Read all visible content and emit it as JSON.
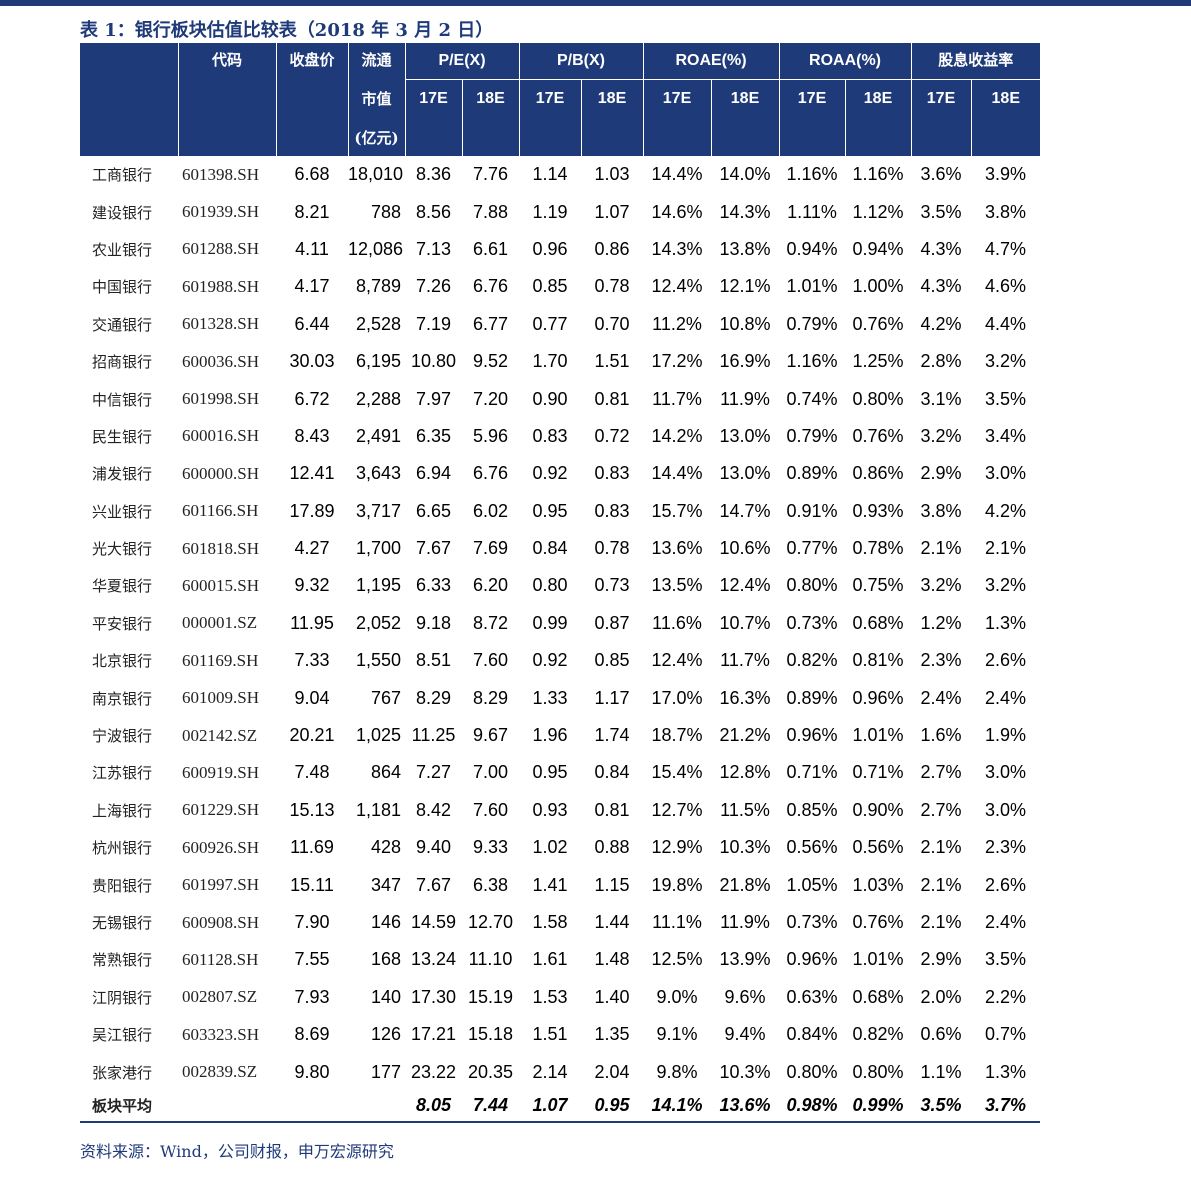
{
  "title": "表 1：银行板块估值比较表（2018 年 3 月 2 日）",
  "headers": {
    "code": "代码",
    "price": "收盘价",
    "cap_line1": "流通",
    "cap_line2": "市值",
    "cap_unit": "(亿元)",
    "pe": "P/E(X)",
    "pb": "P/B(X)",
    "roae": "ROAE(%)",
    "roaa": "ROAA(%)",
    "dy": "股息收益率",
    "y17": "17E",
    "y18": "18E"
  },
  "rows": [
    [
      "工商银行",
      "601398.SH",
      "6.68",
      "18,010",
      "8.36",
      "7.76",
      "1.14",
      "1.03",
      "14.4%",
      "14.0%",
      "1.16%",
      "1.16%",
      "3.6%",
      "3.9%"
    ],
    [
      "建设银行",
      "601939.SH",
      "8.21",
      "788",
      "8.56",
      "7.88",
      "1.19",
      "1.07",
      "14.6%",
      "14.3%",
      "1.11%",
      "1.12%",
      "3.5%",
      "3.8%"
    ],
    [
      "农业银行",
      "601288.SH",
      "4.11",
      "12,086",
      "7.13",
      "6.61",
      "0.96",
      "0.86",
      "14.3%",
      "13.8%",
      "0.94%",
      "0.94%",
      "4.3%",
      "4.7%"
    ],
    [
      "中国银行",
      "601988.SH",
      "4.17",
      "8,789",
      "7.26",
      "6.76",
      "0.85",
      "0.78",
      "12.4%",
      "12.1%",
      "1.01%",
      "1.00%",
      "4.3%",
      "4.6%"
    ],
    [
      "交通银行",
      "601328.SH",
      "6.44",
      "2,528",
      "7.19",
      "6.77",
      "0.77",
      "0.70",
      "11.2%",
      "10.8%",
      "0.79%",
      "0.76%",
      "4.2%",
      "4.4%"
    ],
    [
      "招商银行",
      "600036.SH",
      "30.03",
      "6,195",
      "10.80",
      "9.52",
      "1.70",
      "1.51",
      "17.2%",
      "16.9%",
      "1.16%",
      "1.25%",
      "2.8%",
      "3.2%"
    ],
    [
      "中信银行",
      "601998.SH",
      "6.72",
      "2,288",
      "7.97",
      "7.20",
      "0.90",
      "0.81",
      "11.7%",
      "11.9%",
      "0.74%",
      "0.80%",
      "3.1%",
      "3.5%"
    ],
    [
      "民生银行",
      "600016.SH",
      "8.43",
      "2,491",
      "6.35",
      "5.96",
      "0.83",
      "0.72",
      "14.2%",
      "13.0%",
      "0.79%",
      "0.76%",
      "3.2%",
      "3.4%"
    ],
    [
      "浦发银行",
      "600000.SH",
      "12.41",
      "3,643",
      "6.94",
      "6.76",
      "0.92",
      "0.83",
      "14.4%",
      "13.0%",
      "0.89%",
      "0.86%",
      "2.9%",
      "3.0%"
    ],
    [
      "兴业银行",
      "601166.SH",
      "17.89",
      "3,717",
      "6.65",
      "6.02",
      "0.95",
      "0.83",
      "15.7%",
      "14.7%",
      "0.91%",
      "0.93%",
      "3.8%",
      "4.2%"
    ],
    [
      "光大银行",
      "601818.SH",
      "4.27",
      "1,700",
      "7.67",
      "7.69",
      "0.84",
      "0.78",
      "13.6%",
      "10.6%",
      "0.77%",
      "0.78%",
      "2.1%",
      "2.1%"
    ],
    [
      "华夏银行",
      "600015.SH",
      "9.32",
      "1,195",
      "6.33",
      "6.20",
      "0.80",
      "0.73",
      "13.5%",
      "12.4%",
      "0.80%",
      "0.75%",
      "3.2%",
      "3.2%"
    ],
    [
      "平安银行",
      "000001.SZ",
      "11.95",
      "2,052",
      "9.18",
      "8.72",
      "0.99",
      "0.87",
      "11.6%",
      "10.7%",
      "0.73%",
      "0.68%",
      "1.2%",
      "1.3%"
    ],
    [
      "北京银行",
      "601169.SH",
      "7.33",
      "1,550",
      "8.51",
      "7.60",
      "0.92",
      "0.85",
      "12.4%",
      "11.7%",
      "0.82%",
      "0.81%",
      "2.3%",
      "2.6%"
    ],
    [
      "南京银行",
      "601009.SH",
      "9.04",
      "767",
      "8.29",
      "8.29",
      "1.33",
      "1.17",
      "17.0%",
      "16.3%",
      "0.89%",
      "0.96%",
      "2.4%",
      "2.4%"
    ],
    [
      "宁波银行",
      "002142.SZ",
      "20.21",
      "1,025",
      "11.25",
      "9.67",
      "1.96",
      "1.74",
      "18.7%",
      "21.2%",
      "0.96%",
      "1.01%",
      "1.6%",
      "1.9%"
    ],
    [
      "江苏银行",
      "600919.SH",
      "7.48",
      "864",
      "7.27",
      "7.00",
      "0.95",
      "0.84",
      "15.4%",
      "12.8%",
      "0.71%",
      "0.71%",
      "2.7%",
      "3.0%"
    ],
    [
      "上海银行",
      "601229.SH",
      "15.13",
      "1,181",
      "8.42",
      "7.60",
      "0.93",
      "0.81",
      "12.7%",
      "11.5%",
      "0.85%",
      "0.90%",
      "2.7%",
      "3.0%"
    ],
    [
      "杭州银行",
      "600926.SH",
      "11.69",
      "428",
      "9.40",
      "9.33",
      "1.02",
      "0.88",
      "12.9%",
      "10.3%",
      "0.56%",
      "0.56%",
      "2.1%",
      "2.3%"
    ],
    [
      "贵阳银行",
      "601997.SH",
      "15.11",
      "347",
      "7.67",
      "6.38",
      "1.41",
      "1.15",
      "19.8%",
      "21.8%",
      "1.05%",
      "1.03%",
      "2.1%",
      "2.6%"
    ],
    [
      "无锡银行",
      "600908.SH",
      "7.90",
      "146",
      "14.59",
      "12.70",
      "1.58",
      "1.44",
      "11.1%",
      "11.9%",
      "0.73%",
      "0.76%",
      "2.1%",
      "2.4%"
    ],
    [
      "常熟银行",
      "601128.SH",
      "7.55",
      "168",
      "13.24",
      "11.10",
      "1.61",
      "1.48",
      "12.5%",
      "13.9%",
      "0.96%",
      "1.01%",
      "2.9%",
      "3.5%"
    ],
    [
      "江阴银行",
      "002807.SZ",
      "7.93",
      "140",
      "17.30",
      "15.19",
      "1.53",
      "1.40",
      "9.0%",
      "9.6%",
      "0.63%",
      "0.68%",
      "2.0%",
      "2.2%"
    ],
    [
      "吴江银行",
      "603323.SH",
      "8.69",
      "126",
      "17.21",
      "15.18",
      "1.51",
      "1.35",
      "9.1%",
      "9.4%",
      "0.84%",
      "0.82%",
      "0.6%",
      "0.7%"
    ],
    [
      "张家港行",
      "002839.SZ",
      "9.80",
      "177",
      "23.22",
      "20.35",
      "2.14",
      "2.04",
      "9.8%",
      "10.3%",
      "0.80%",
      "0.80%",
      "1.1%",
      "1.3%"
    ]
  ],
  "average": [
    "板块平均",
    "",
    "",
    "",
    "8.05",
    "7.44",
    "1.07",
    "0.95",
    "14.1%",
    "13.6%",
    "0.98%",
    "0.99%",
    "3.5%",
    "3.7%"
  ],
  "source": "资料来源：Wind，公司财报，申万宏源研究"
}
